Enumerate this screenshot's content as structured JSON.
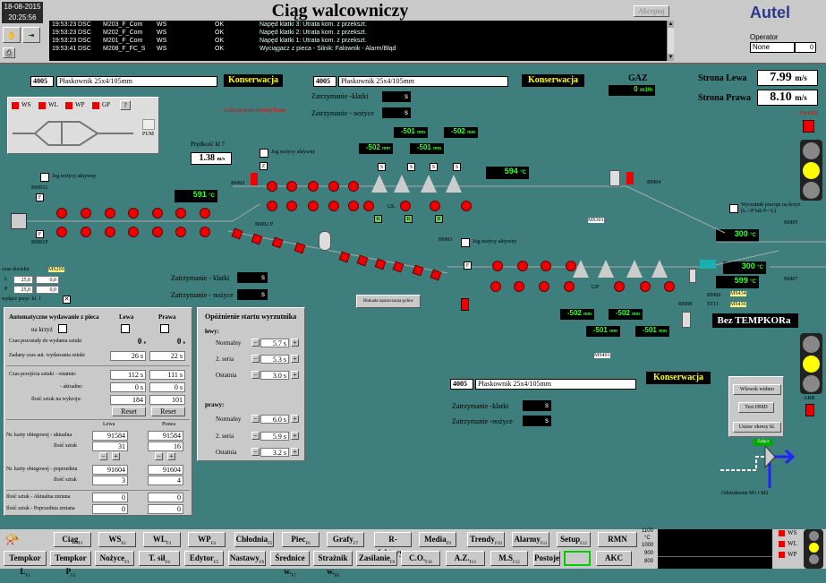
{
  "header": {
    "date": "18-08-2015",
    "time": "20:25:56",
    "title": "Ciąg walcowniczy",
    "accept_label": "Akceptuj",
    "brand": "Autel",
    "operator_label": "Operator",
    "operator_value": "None",
    "operator_num": "0"
  },
  "alarms": [
    {
      "time": "19:53:23",
      "type": "DSC",
      "source": "M203_F_Com",
      "ws": "WS",
      "state": "OK",
      "msg": "Napęd klatki 3: Utrata kom. z przekszt."
    },
    {
      "time": "19:53:23",
      "type": "DSC",
      "source": "M202_F_Com",
      "ws": "WS",
      "state": "OK",
      "msg": "Napęd klatki 2: Utrata kom. z przekszt."
    },
    {
      "time": "19:53:23",
      "type": "DSC",
      "source": "M201_F_Com",
      "ws": "WS",
      "state": "OK",
      "msg": "Napęd klatki 1: Utrata kom. z przekszt."
    },
    {
      "time": "19:53:41",
      "type": "DSC",
      "source": "M208_F_FC_S",
      "ws": "WS",
      "state": "OK",
      "msg": "Wyciągacz z pieca - Silnik: Falownik - Alarm/Błąd"
    }
  ],
  "top": {
    "id1": "4005",
    "prod1": "Płaskownik 25x4/105mm",
    "kons1": "Konserwacja",
    "walc": "walcowanie dwustyfowe",
    "id2": "4005",
    "prod2": "Płaskownik 25x4/105mm",
    "kons2": "Konserwacja",
    "zk_label": "Zatrzymanie -klatki",
    "zk_val": "s",
    "zn_label": "Zatrzymanie - nożyce",
    "zn_val": "s",
    "gaz_label": "GAZ",
    "gaz_val": "0",
    "gaz_unit": "m3/h",
    "strona_lewa": "Strona Lewa",
    "strona_lewa_val": "7.99",
    "strona_prawa": "Strona Prawa",
    "strona_prawa_val": "8.10",
    "unit_ms": "m/s"
  },
  "legend": {
    "ws": "WS",
    "wl": "WL",
    "wp": "WP",
    "gp": "GP",
    "q": "?",
    "pum": "PUM"
  },
  "process": {
    "predkosc_label": "Prędkość kl 7",
    "predkosc_val": "1.38",
    "predkosc_unit": "m/s",
    "jog1": "Jog nożycy aktywny",
    "jog2": "Jog nożycy aktywny",
    "jog3": "Jog nożycy aktywny",
    "t591": "591",
    "t594": "594",
    "t300a": "300",
    "t300b": "300",
    "t599": "599",
    "deg": "°C",
    "r1": "-501",
    "r2": "-502",
    "r3": "-502",
    "r4": "-501",
    "r5": "-502",
    "r6": "-502",
    "r7": "-501",
    "r8": "-501",
    "mm": "mm",
    "bm01l": "BM01L",
    "bm01p": "BM01P",
    "bm02": "BM02",
    "bm02p": "BM02 P",
    "bm03": "BM03",
    "bm04": "BM04",
    "bm05": "BM05",
    "bm06": "BM06",
    "bm07": "BM07",
    "bm08": "BM08",
    "ms209": "MS209",
    "ms301": "MS301",
    "ms401": "MS401",
    "ms434": "MS434",
    "ms436": "MS436",
    "st11": "ST11",
    "czas_dociskow": "czas dociskn",
    "l_label": "L",
    "p_label": "P",
    "l_a": "25,0",
    "l_b": "0,0",
    "p_a": "25,0",
    "p_b": "0,0",
    "wylacz": "wyłącz przyc kl. 1",
    "wyrzutnik": "Wyrzutnik pracuje na krzyż (L->P lub P->L)",
    "blokada": "Blokada opuszczania pyłów",
    "zk2_label": "Zatrzymanie - klatki",
    "zk2_val": "s",
    "zn2_label": "Zatrzymanie - nożyce",
    "zn2_val": "s",
    "bez": "Bez TEMPKORa",
    "twerd": "TWERD",
    "abb": "ABB",
    "z12l": "12L",
    "z12p": "12P",
    "id3": "4005",
    "prod3": "Płaskownik 25x4/105mm",
    "kons3": "Konserwacja",
    "zk3_label": "Zatrzymanie -klatki",
    "zk3_val": "s",
    "zn3_label": "Zatrzymanie -nożyce",
    "zn3_val": "s",
    "wlewek": "Wlewek widmo",
    "test": "Test HMD",
    "ustaw": "Ustaw okresy kl.",
    "odsiedzenie": "Odsiedzenie M1 i M2",
    "zalacz": "Załącz"
  },
  "left_panel": {
    "auto_label": "Automatyczne wydawanie z pieca",
    "na_krzyz": "na krzyż",
    "lewa": "Lewa",
    "prawa": "Prawa",
    "czas_poz": "Czas pozostały do wydania sztuki",
    "czas_poz_l": "0",
    "czas_poz_p": "0",
    "unit_s": "s",
    "zadany": "Zadany czas aut. wydawania sztuki",
    "zadany_l": "26 s",
    "zadany_p": "22 s",
    "czas_przej": "Czas przejścia sztuki - ostatnie:",
    "cp_l": "112 s",
    "cp_p": "111 s",
    "aktualne": "- aktualne:",
    "akt_l": "0 s",
    "akt_p": "0 s",
    "ilosc_wykr": "Ilość sztuk na wykroju:",
    "iw_l": "184",
    "iw_p": "101",
    "reset": "Reset",
    "karty_lewa": "Lewa",
    "karty_prawa": "Prawa",
    "nr_akt": "Nr. karty obiegowej - aktualna",
    "nr_akt_l": "91584",
    "nr_akt_p": "91584",
    "il_szt": "Ilość sztuk",
    "il_szt_l": "31",
    "il_szt_p": "16",
    "nr_pop": "Nr. karty obiegowej - poprzednia",
    "nr_pop_l": "91604",
    "nr_pop_p": "91604",
    "il_szt2": "Ilość sztuk",
    "il_szt2_l": "3",
    "il_szt2_p": "4",
    "il_akt": "Ilość sztuk - Aktualna zmiana",
    "il_akt_l": "0",
    "il_akt_p": "0",
    "il_pop": "Ilość sztuk - Poprzednia zmiana",
    "il_pop_l": "0",
    "il_pop_p": "0"
  },
  "delay_panel": {
    "title": "Opóźnienie startu wyrzutnika",
    "lewy": "lewy:",
    "prawy": "prawy:",
    "normalny": "Normalny",
    "seria": "2. seria",
    "ostatnia": "Ostatnia",
    "l_norm": "5.7",
    "l_seria": "5.3",
    "l_ost": "3.0",
    "p_norm": "6.0",
    "p_seria": "5.9",
    "p_ost": "3.2",
    "s": "s"
  },
  "bottom": {
    "row1": [
      "Ciąg",
      "WS",
      "WL",
      "WP",
      "Chłodnia",
      "Piec",
      "Grafy",
      "R-faktory",
      "Media",
      "Trendy",
      "Alarmy",
      "Setup",
      "RMN"
    ],
    "row1_f": [
      "F1",
      "F2",
      "F3",
      "F4",
      "F5",
      "F6",
      "F7",
      "F8",
      "F9",
      "F10",
      "F11",
      "F12",
      ""
    ],
    "row2": [
      "Tempkor L",
      "Tempkor P",
      "Nożyce",
      "T. sił",
      "Edytor",
      "Nastawy",
      "Średnice w.",
      "Strażnik w.",
      "Zasilanie",
      "C.O.",
      "A.Z.",
      "M.S",
      "Postoje",
      "AKC"
    ],
    "row2_f": [
      "F1",
      "F2",
      "F3",
      "F4",
      "F5",
      "F6",
      "F7",
      "F8",
      "F9",
      "F10",
      "F11",
      "F12",
      "",
      ""
    ],
    "temp_axis": [
      "1100",
      "°C",
      "1000",
      "900",
      "800"
    ],
    "leg": [
      "WS",
      "WL",
      "WP"
    ]
  },
  "colors": {
    "bg": "#3e7f7e",
    "red": "#e00000",
    "panel": "#c9c9c9"
  }
}
